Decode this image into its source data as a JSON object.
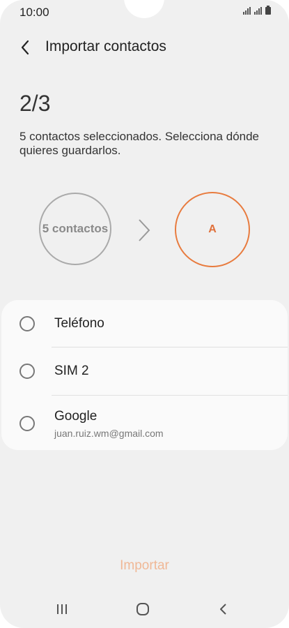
{
  "status_bar": {
    "time": "10:00"
  },
  "header": {
    "back_icon": "chevron-left-icon",
    "title": "Importar contactos"
  },
  "step": "2/3",
  "description": "5 contactos seleccionados. Selecciona dónde quieres guardarlos.",
  "transfer": {
    "source_label": "5 contactos",
    "arrow_icon": "chevron-right-icon",
    "target_label": "A",
    "accent_color": "#e87b3e"
  },
  "options": [
    {
      "label": "Teléfono"
    },
    {
      "label": "SIM 2"
    },
    {
      "label": "Google",
      "sublabel": "juan.ruiz.wm@gmail.com"
    }
  ],
  "import_button": "Importar",
  "nav_bar": {
    "recents_icon": "recents-icon",
    "home_icon": "home-icon",
    "back_icon": "back-icon"
  }
}
